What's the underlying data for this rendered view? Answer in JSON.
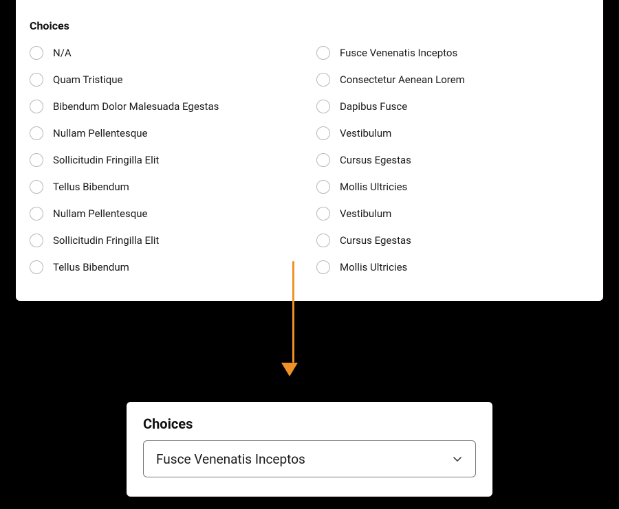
{
  "top": {
    "title": "Choices",
    "left_column": [
      "N/A",
      "Quam Tristique",
      "Bibendum Dolor Malesuada Egestas",
      "Nullam Pellentesque",
      "Sollicitudin Fringilla Elit",
      "Tellus Bibendum",
      "Nullam Pellentesque",
      "Sollicitudin Fringilla Elit",
      "Tellus Bibendum"
    ],
    "right_column": [
      "Fusce Venenatis Inceptos",
      "Consectetur Aenean Lorem",
      "Dapibus Fusce",
      "Vestibulum",
      "Cursus Egestas",
      "Mollis Ultricies",
      "Vestibulum",
      "Cursus Egestas",
      "Mollis Ultricies"
    ]
  },
  "bottom": {
    "title": "Choices",
    "selected": "Fusce Venenatis Inceptos"
  },
  "colors": {
    "arrow": "#ef9127"
  }
}
